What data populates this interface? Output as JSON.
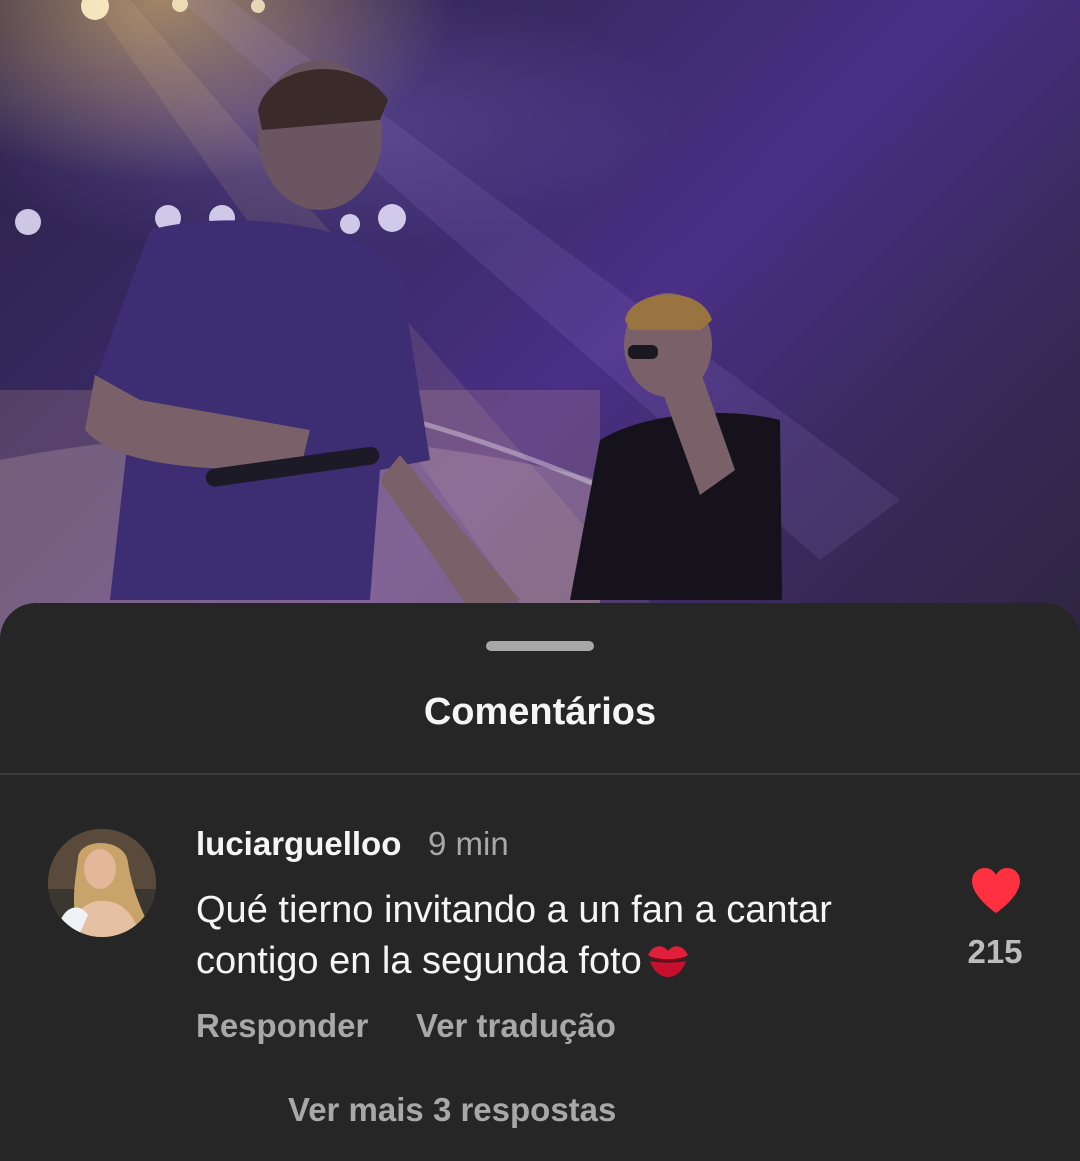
{
  "sheet": {
    "title": "Comentários"
  },
  "comment": {
    "username": "luciarguelloo",
    "time": "9 min",
    "text": "Qué tierno invitando a un fan a cantar contigo en la segunda foto",
    "emoji_icon": "kiss-mark-icon",
    "likes": "215",
    "reply_label": "Responder",
    "translate_label": "Ver tradução"
  },
  "replies": {
    "more_label": "Ver mais 3 respostas"
  },
  "colors": {
    "background": "#262626",
    "text_primary": "#f5f5f5",
    "text_secondary": "#a8a8a8",
    "like_red": "#ff3040"
  }
}
